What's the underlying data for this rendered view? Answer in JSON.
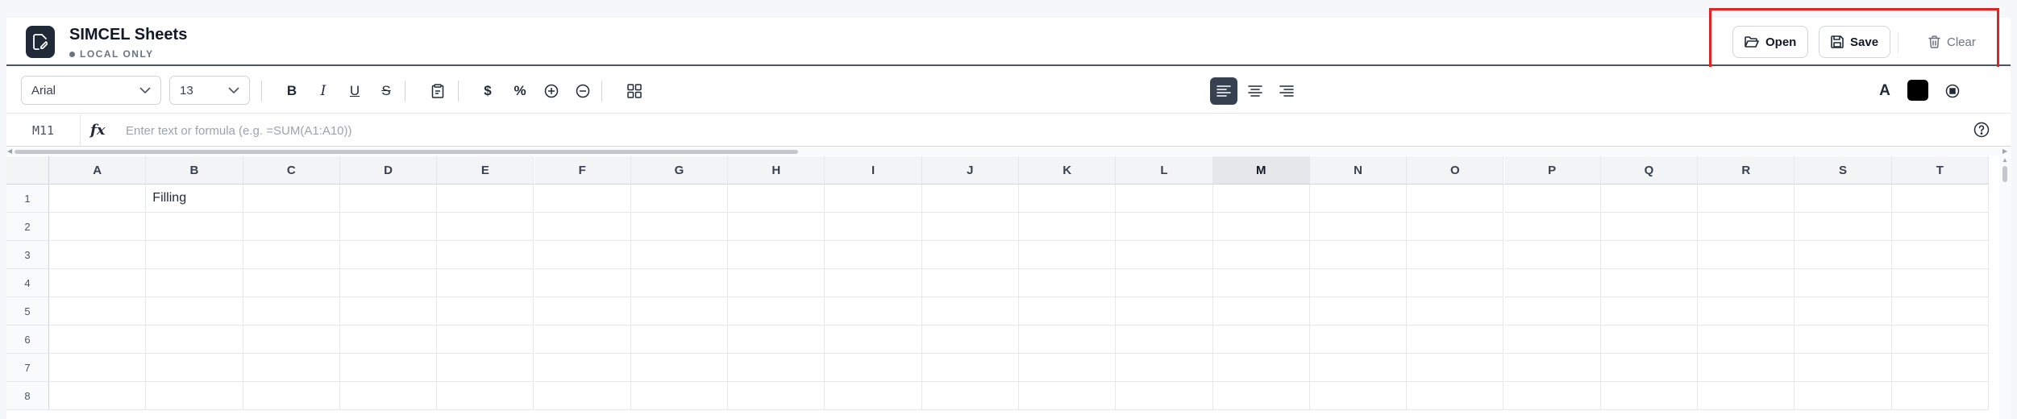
{
  "header": {
    "title": "SIMCEL Sheets",
    "subtitle": "LOCAL ONLY",
    "open_label": "Open",
    "save_label": "Save",
    "clear_label": "Clear"
  },
  "toolbar": {
    "font_family": "Arial",
    "font_size": "13",
    "bold": "B",
    "italic": "I",
    "underline": "U",
    "strike": "S",
    "currency": "$",
    "percent": "%",
    "text_color_label": "A",
    "fill_color": "#000000",
    "active_alignment": "left"
  },
  "formula_bar": {
    "cell_ref": "M11",
    "fx": "fx",
    "placeholder": "Enter text or formula (e.g. =SUM(A1:A10))",
    "value": ""
  },
  "grid": {
    "columns": [
      "A",
      "B",
      "C",
      "D",
      "E",
      "F",
      "G",
      "H",
      "I",
      "J",
      "K",
      "L",
      "M",
      "N",
      "O",
      "P",
      "Q",
      "R",
      "S",
      "T"
    ],
    "active_column": "M",
    "rows": [
      "1",
      "2",
      "3",
      "4",
      "5",
      "6",
      "7",
      "8"
    ],
    "cells": {
      "B1": "Filling"
    }
  },
  "colors": {
    "accent_dark": "#1f2937",
    "highlight_box": "#dc2626"
  }
}
